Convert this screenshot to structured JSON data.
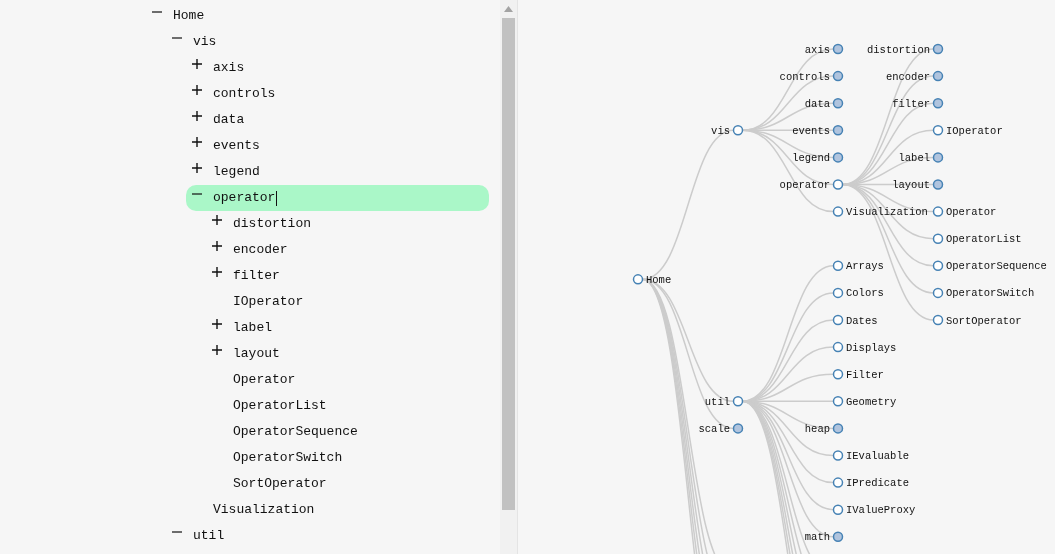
{
  "tree": {
    "items": [
      {
        "label": "Home",
        "kind": "folder",
        "expanded": true,
        "selected": false,
        "children": [
          {
            "label": "vis",
            "kind": "folder",
            "expanded": true,
            "selected": false,
            "children": [
              {
                "label": "axis",
                "kind": "folder",
                "expanded": false,
                "selected": false
              },
              {
                "label": "controls",
                "kind": "folder",
                "expanded": false,
                "selected": false
              },
              {
                "label": "data",
                "kind": "folder",
                "expanded": false,
                "selected": false
              },
              {
                "label": "events",
                "kind": "folder",
                "expanded": false,
                "selected": false
              },
              {
                "label": "legend",
                "kind": "folder",
                "expanded": false,
                "selected": false
              },
              {
                "label": "operator",
                "kind": "folder",
                "expanded": true,
                "selected": true,
                "editing": true,
                "children": [
                  {
                    "label": "distortion",
                    "kind": "folder",
                    "expanded": false,
                    "selected": false
                  },
                  {
                    "label": "encoder",
                    "kind": "folder",
                    "expanded": false,
                    "selected": false
                  },
                  {
                    "label": "filter",
                    "kind": "folder",
                    "expanded": false,
                    "selected": false
                  },
                  {
                    "label": "IOperator",
                    "kind": "leaf",
                    "selected": false
                  },
                  {
                    "label": "label",
                    "kind": "folder",
                    "expanded": false,
                    "selected": false
                  },
                  {
                    "label": "layout",
                    "kind": "folder",
                    "expanded": false,
                    "selected": false
                  },
                  {
                    "label": "Operator",
                    "kind": "leaf",
                    "selected": false
                  },
                  {
                    "label": "OperatorList",
                    "kind": "leaf",
                    "selected": false
                  },
                  {
                    "label": "OperatorSequence",
                    "kind": "leaf",
                    "selected": false
                  },
                  {
                    "label": "OperatorSwitch",
                    "kind": "leaf",
                    "selected": false
                  },
                  {
                    "label": "SortOperator",
                    "kind": "leaf",
                    "selected": false
                  }
                ]
              },
              {
                "label": "Visualization",
                "kind": "leaf",
                "selected": false
              }
            ]
          },
          {
            "label": "util",
            "kind": "folder",
            "expanded": true,
            "selected": false
          }
        ]
      }
    ]
  },
  "graph": {
    "root": {
      "label": "Home",
      "collapsed": false,
      "continues": true,
      "children": [
        {
          "label": "vis",
          "collapsed": false,
          "children": [
            {
              "label": "axis",
              "collapsed": true
            },
            {
              "label": "controls",
              "collapsed": true
            },
            {
              "label": "data",
              "collapsed": true
            },
            {
              "label": "events",
              "collapsed": true
            },
            {
              "label": "legend",
              "collapsed": true
            },
            {
              "label": "operator",
              "collapsed": false,
              "children": [
                {
                  "label": "distortion",
                  "collapsed": true
                },
                {
                  "label": "encoder",
                  "collapsed": true
                },
                {
                  "label": "filter",
                  "collapsed": true
                },
                {
                  "label": "IOperator",
                  "collapsed": false
                },
                {
                  "label": "label",
                  "collapsed": true
                },
                {
                  "label": "layout",
                  "collapsed": true
                },
                {
                  "label": "Operator",
                  "collapsed": false
                },
                {
                  "label": "OperatorList",
                  "collapsed": false
                },
                {
                  "label": "OperatorSequence",
                  "collapsed": false
                },
                {
                  "label": "OperatorSwitch",
                  "collapsed": false
                },
                {
                  "label": "SortOperator",
                  "collapsed": false
                }
              ]
            },
            {
              "label": "Visualization",
              "collapsed": false
            }
          ]
        },
        {
          "label": "util",
          "collapsed": false,
          "continues": true,
          "children": [
            {
              "label": "Arrays",
              "collapsed": false
            },
            {
              "label": "Colors",
              "collapsed": false
            },
            {
              "label": "Dates",
              "collapsed": false
            },
            {
              "label": "Displays",
              "collapsed": false
            },
            {
              "label": "Filter",
              "collapsed": false
            },
            {
              "label": "Geometry",
              "collapsed": false
            },
            {
              "label": "heap",
              "collapsed": true
            },
            {
              "label": "IEvaluable",
              "collapsed": false
            },
            {
              "label": "IPredicate",
              "collapsed": false
            },
            {
              "label": "IValueProxy",
              "collapsed": false
            },
            {
              "label": "math",
              "collapsed": true
            }
          ]
        },
        {
          "label": "scale",
          "collapsed": true
        }
      ]
    }
  }
}
